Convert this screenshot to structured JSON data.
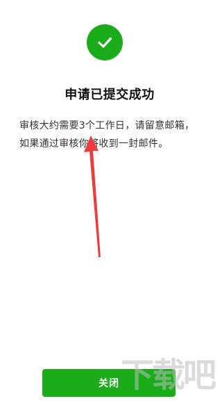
{
  "status": {
    "icon": "checkmark-circle-icon",
    "color": "#1aad19"
  },
  "title": "申请已提交成功",
  "description": "审核大约需要3个工作日，请留意邮箱，如果通过审核你将收到一封邮件。",
  "annotation": {
    "icon": "red-arrow-icon",
    "color": "#ef3b3b"
  },
  "close_button": {
    "label": "关闭",
    "color": "#1aad19"
  },
  "watermark": {
    "icon": "download-site-logo-icon",
    "text": "下载吧"
  }
}
